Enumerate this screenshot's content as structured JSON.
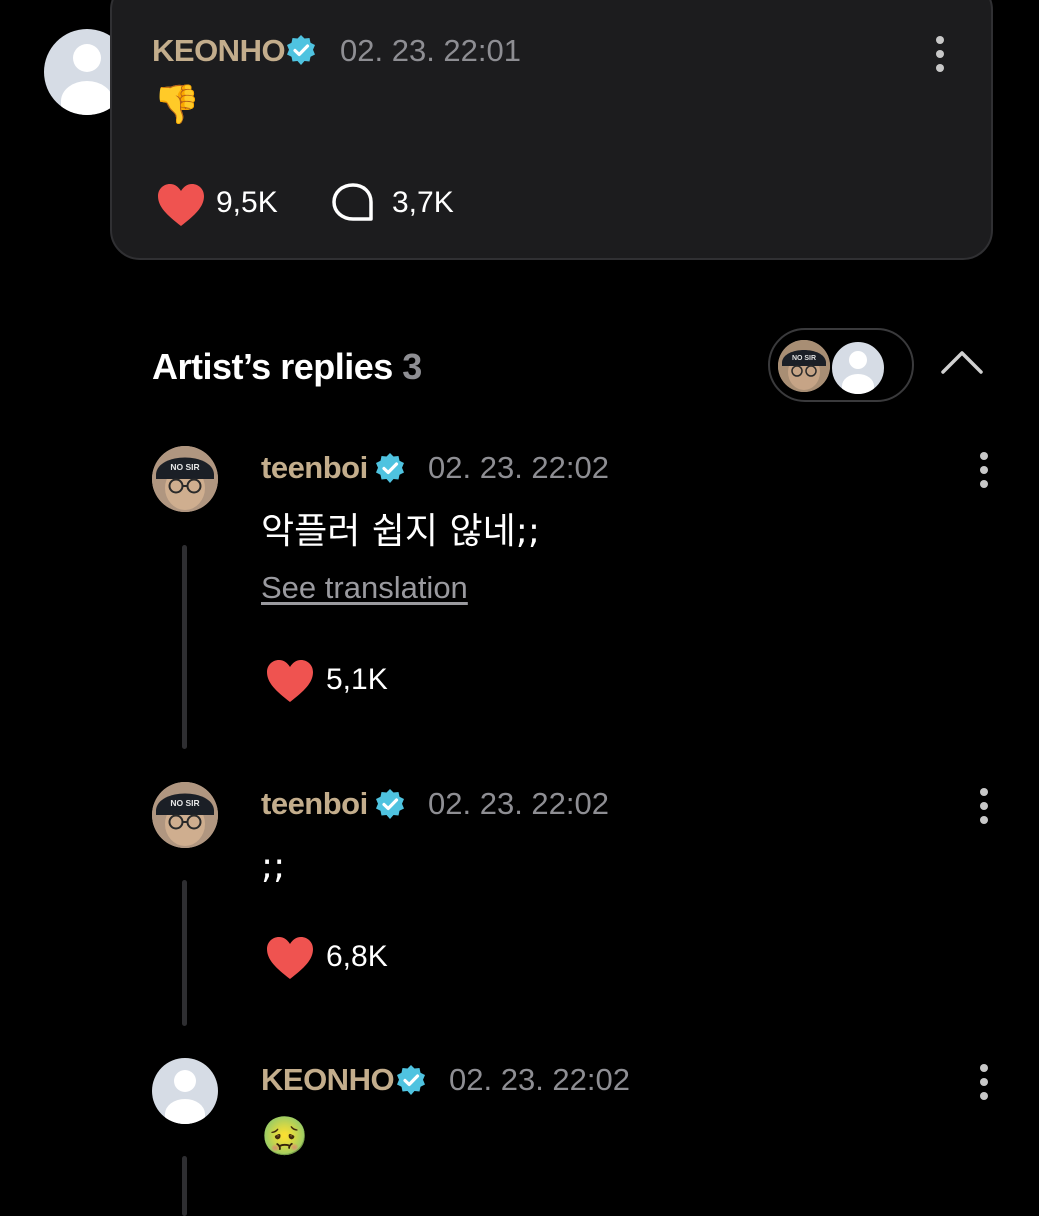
{
  "post": {
    "author": "KEONHO",
    "timestamp": "02. 23. 22:01",
    "content_emoji": "👎",
    "likes": "9,5K",
    "comments": "3,7K"
  },
  "replies_section": {
    "title": "Artist’s replies",
    "count": "3"
  },
  "replies": [
    {
      "author": "teenboi",
      "timestamp": "02. 23. 22:02",
      "text": "악플러 쉽지 않네;;",
      "see_translation": "See translation",
      "likes": "5,1K",
      "cap_text": "NO SIR"
    },
    {
      "author": "teenboi",
      "timestamp": "02. 23. 22:02",
      "text": ";;",
      "likes": "6,8K",
      "cap_text": "NO SIR"
    },
    {
      "author": "KEONHO",
      "timestamp": "02. 23. 22:02",
      "content_emoji": "🤢"
    }
  ],
  "colors": {
    "background": "#000000",
    "card": "#1c1c1e",
    "author_name": "#c3ad8c",
    "timestamp": "#8e8e93",
    "heart": "#ef5350",
    "verified": "#4fc3e0"
  }
}
